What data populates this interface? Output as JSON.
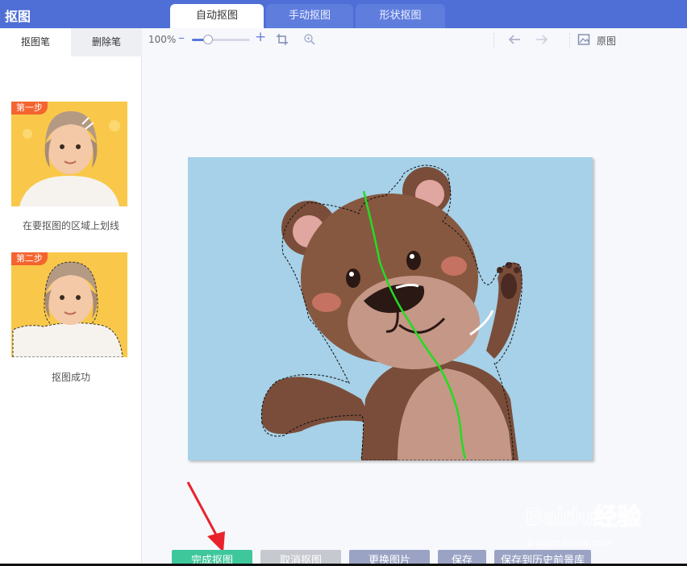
{
  "app": {
    "title": "抠图"
  },
  "tabs": [
    {
      "label": "自动抠图",
      "active": true
    },
    {
      "label": "手动抠图",
      "active": false
    },
    {
      "label": "形状抠图",
      "active": false
    }
  ],
  "sidebar": {
    "tabs": [
      {
        "label": "抠图笔"
      },
      {
        "label": "删除笔"
      }
    ],
    "steps": [
      {
        "badge": "第一步",
        "caption": "在要抠图的区域上划线"
      },
      {
        "badge": "第二步",
        "caption": "抠图成功"
      }
    ]
  },
  "toolbar": {
    "zoom": "100%",
    "zoom_minus": "–",
    "zoom_plus": "+",
    "zoom_level": 0.28,
    "original_label": "原图"
  },
  "buttons": {
    "done": "完成抠图",
    "cancel": "取消抠图",
    "replace": "更换图片",
    "save": "保存",
    "save_history": "保存到历史前景库"
  },
  "watermark": {
    "brand": "Baidu经验",
    "url": "jingyan.baidu.com"
  },
  "colors": {
    "topbar": "#4f6fd6",
    "accent": "#3fc79c",
    "canvas_bg": "#a6d1e8",
    "stroke": "#22dd22",
    "arrow": "#e8232b"
  }
}
